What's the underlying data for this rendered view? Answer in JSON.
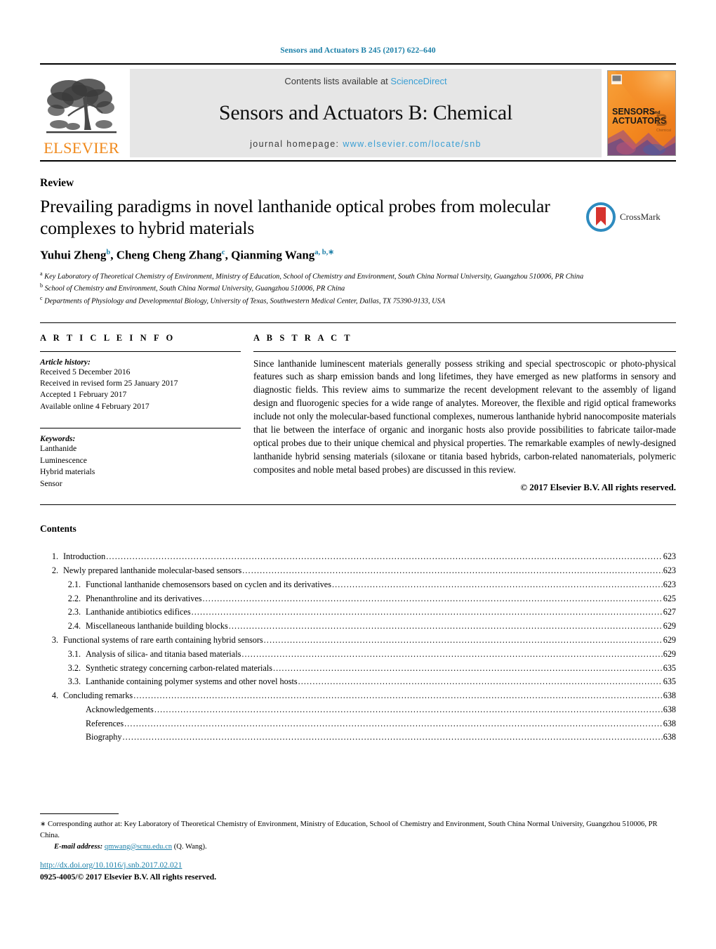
{
  "running_head": "Sensors and Actuators B 245 (2017) 622–640",
  "masthead": {
    "publisher_name": "ELSEVIER",
    "contents_prefix": "Contents lists available at",
    "contents_link": "ScienceDirect",
    "journal_title": "Sensors and Actuators B: Chemical",
    "homepage_label": "journal homepage:",
    "homepage_url": "www.elsevier.com/locate/snb",
    "cover": {
      "line1": "SENSORS",
      "line1_suffix": "and",
      "line2": "ACTUATORS",
      "volume_letter": "B",
      "volume_sub": "Chemical"
    },
    "colors": {
      "link_blue": "#3a9fd4",
      "elsevier_orange": "#f08a1d",
      "band_grey": "#e6e6e6"
    }
  },
  "article": {
    "doctype": "Review",
    "title": "Prevailing paradigms in novel lanthanide optical probes from molecular complexes to hybrid materials",
    "authors": [
      {
        "name": "Yuhui Zheng",
        "marks": "b"
      },
      {
        "name": "Cheng Cheng Zhang",
        "marks": "c"
      },
      {
        "name": "Qianming Wang",
        "marks": "a, b,∗"
      }
    ],
    "affiliations": [
      {
        "mark": "a",
        "text": "Key Laboratory of Theoretical Chemistry of Environment, Ministry of Education, School of Chemistry and Environment, South China Normal University, Guangzhou 510006, PR China"
      },
      {
        "mark": "b",
        "text": "School of Chemistry and Environment, South China Normal University, Guangzhou 510006, PR China"
      },
      {
        "mark": "c",
        "text": "Departments of Physiology and Developmental Biology, University of Texas, Southwestern Medical Center, Dallas, TX 75390-9133, USA"
      }
    ],
    "crossmark_label": "CrossMark"
  },
  "info": {
    "heading": "A R T I C L E    I N F O",
    "history_label": "Article history:",
    "history": [
      "Received 5 December 2016",
      "Received in revised form 25 January 2017",
      "Accepted 1 February 2017",
      "Available online 4 February 2017"
    ],
    "keywords_label": "Keywords:",
    "keywords": [
      "Lanthanide",
      "Luminescence",
      "Hybrid materials",
      "Sensor"
    ]
  },
  "abstract": {
    "heading": "A B S T R A C T",
    "text": "Since lanthanide luminescent materials generally possess striking and special spectroscopic or photo-physical features such as sharp emission bands and long lifetimes, they have emerged as new platforms in sensory and diagnostic fields. This review aims to summarize the recent development relevant to the assembly of ligand design and fluorogenic species for a wide range of analytes. Moreover, the flexible and rigid optical frameworks include not only the molecular-based functional complexes, numerous lanthanide hybrid nanocomposite materials that lie between the interface of organic and inorganic hosts also provide possibilities to fabricate tailor-made optical probes due to their unique chemical and physical properties. The remarkable examples of newly-designed lanthanide hybrid sensing materials (siloxane or titania based hybrids, carbon-related nanomaterials, polymeric composites and noble metal based probes) are discussed in this review.",
    "copyright": "© 2017 Elsevier B.V. All rights reserved."
  },
  "contents": {
    "heading": "Contents",
    "entries": [
      {
        "level": 1,
        "num": "1.",
        "label": "Introduction",
        "page": "623"
      },
      {
        "level": 1,
        "num": "2.",
        "label": "Newly prepared lanthanide molecular-based sensors",
        "page": "623"
      },
      {
        "level": 2,
        "num": "2.1.",
        "label": "Functional lanthanide chemosensors based on cyclen and its derivatives",
        "page": "623"
      },
      {
        "level": 2,
        "num": "2.2.",
        "label": "Phenanthroline and its derivatives",
        "page": "625"
      },
      {
        "level": 2,
        "num": "2.3.",
        "label": "Lanthanide antibiotics edifices",
        "page": "627"
      },
      {
        "level": 2,
        "num": "2.4.",
        "label": "Miscellaneous lanthanide building blocks",
        "page": "629"
      },
      {
        "level": 1,
        "num": "3.",
        "label": "Functional systems of rare earth containing hybrid sensors",
        "page": "629"
      },
      {
        "level": 2,
        "num": "3.1.",
        "label": "Analysis of silica- and titania based materials",
        "page": "629"
      },
      {
        "level": 2,
        "num": "3.2.",
        "label": "Synthetic strategy concerning carbon-related materials",
        "page": "635"
      },
      {
        "level": 2,
        "num": "3.3.",
        "label": "Lanthanide containing polymer systems and other novel hosts",
        "page": "635"
      },
      {
        "level": 1,
        "num": "4.",
        "label": "Concluding remarks",
        "page": "638"
      },
      {
        "level": 0,
        "num": "",
        "label": "Acknowledgements",
        "page": "638"
      },
      {
        "level": 0,
        "num": "",
        "label": "References",
        "page": "638"
      },
      {
        "level": 0,
        "num": "",
        "label": "Biography",
        "page": "638"
      }
    ]
  },
  "footer": {
    "corresponding_note": "Corresponding author at: Key Laboratory of Theoretical Chemistry of Environment, Ministry of Education, School of Chemistry and Environment, South China Normal University, Guangzhou 510006, PR China.",
    "email_label": "E-mail address:",
    "email": "qmwang@scnu.edu.cn",
    "email_suffix": "(Q. Wang).",
    "doi": "http://dx.doi.org/10.1016/j.snb.2017.02.021",
    "issn_line": "0925-4005/© 2017 Elsevier B.V. All rights reserved."
  }
}
